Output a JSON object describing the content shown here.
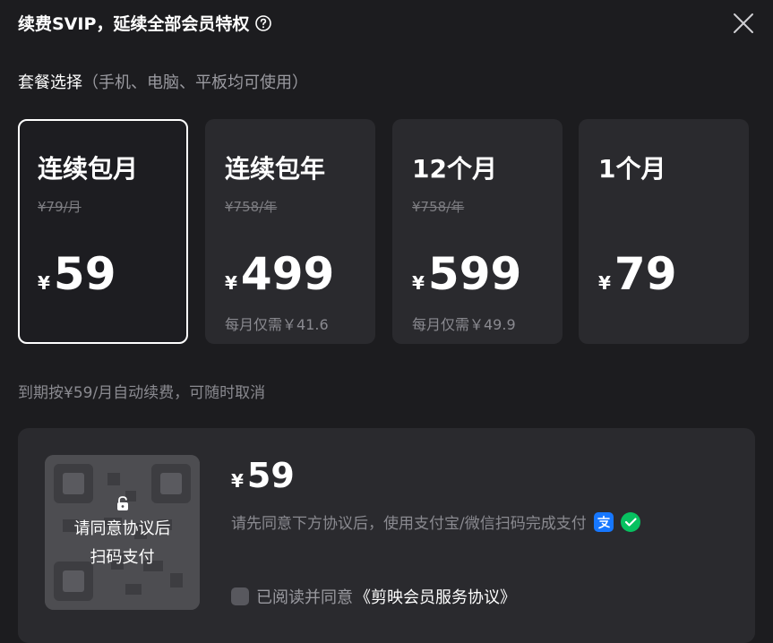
{
  "header": {
    "title": "续费SVIP，延续全部会员特权"
  },
  "section": {
    "title": "套餐选择",
    "subtitle": "（手机、电脑、平板均可使用）"
  },
  "plans": [
    {
      "name": "连续包月",
      "original": "¥79/月",
      "currency": "¥",
      "price": "59",
      "monthly": "",
      "selected": true
    },
    {
      "name": "连续包年",
      "original": "¥758/年",
      "currency": "¥",
      "price": "499",
      "monthly": "每月仅需￥41.6",
      "selected": false
    },
    {
      "name": "12个月",
      "original": "¥758/年",
      "currency": "¥",
      "price": "599",
      "monthly": "每月仅需￥49.9",
      "selected": false
    },
    {
      "name": "1个月",
      "original": "",
      "currency": "¥",
      "price": "79",
      "monthly": "",
      "selected": false
    }
  ],
  "renew_note": "到期按¥59/月自动续费，可随时取消",
  "payment": {
    "qr_overlay_line1": "请同意协议后",
    "qr_overlay_line2": "扫码支付",
    "currency": "¥",
    "amount": "59",
    "hint": "请先同意下方协议后，使用支付宝/微信扫码完成支付",
    "agree_label": "已阅读并同意",
    "agreement_link": "《剪映会员服务协议》",
    "icons": [
      "alipay-icon",
      "wechat-pay-icon"
    ]
  },
  "colors": {
    "background": "#1c1c1f",
    "card": "#2a2a2e",
    "alipay": "#1677ff",
    "wechat": "#07c160"
  }
}
